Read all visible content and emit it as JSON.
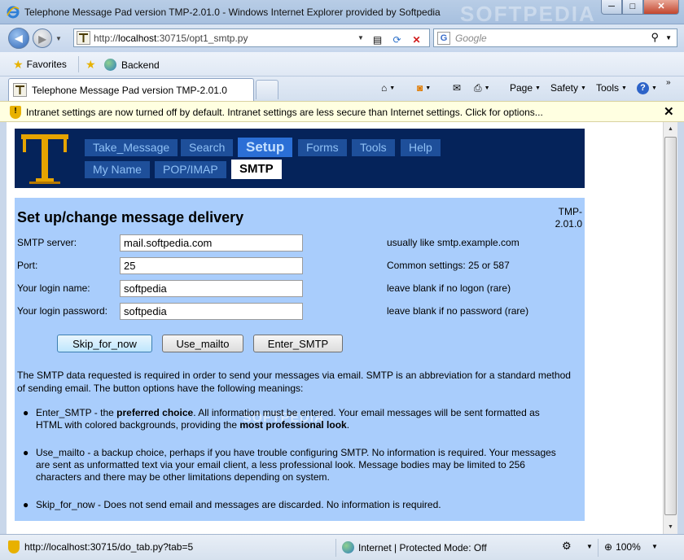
{
  "window": {
    "title": "Telephone Message Pad version TMP-2.01.0 - Windows Internet Explorer provided by Softpedia",
    "watermark": "SOFTPEDIA",
    "controls": {
      "minimize": "─",
      "maximize": "□",
      "close": "✕"
    }
  },
  "address_bar": {
    "url_prefix": "http://",
    "url_host": "localhost",
    "url_rest": ":30715/opt1_smtp.py"
  },
  "search": {
    "placeholder": "Google",
    "engine_letter": "G"
  },
  "favorites_bar": {
    "favorites_label": "Favorites",
    "link_backend": "Backend"
  },
  "tab": {
    "label": "Telephone Message Pad version TMP-2.01.0"
  },
  "command_bar": {
    "page": "Page",
    "safety": "Safety",
    "tools": "Tools",
    "help": "?"
  },
  "info_bar": {
    "message": "Intranet settings are now turned off by default. Intranet settings are less secure than Internet settings. Click for options...",
    "close": "✕"
  },
  "app_nav": {
    "logo_letter": "T",
    "main_tabs": [
      {
        "label": "Take_Message"
      },
      {
        "label": "Search"
      },
      {
        "label": "Setup"
      },
      {
        "label": "Forms"
      },
      {
        "label": "Tools"
      },
      {
        "label": "Help"
      }
    ],
    "sub_tabs": [
      {
        "label": "My Name"
      },
      {
        "label": "POP/IMAP"
      },
      {
        "label": "SMTP"
      }
    ],
    "active_main": "Setup",
    "active_sub": "SMTP"
  },
  "form": {
    "heading": "Set up/change message delivery",
    "version_line1": "TMP-",
    "version_line2": "2.01.0",
    "fields": [
      {
        "label": "SMTP server:",
        "value": "mail.softpedia.com",
        "hint": "usually like smtp.example.com"
      },
      {
        "label": "Port:",
        "value": "25",
        "hint": "Common settings: 25 or 587"
      },
      {
        "label": "Your login name:",
        "value": "softpedia",
        "hint": "leave blank if no logon (rare)"
      },
      {
        "label": "Your login password:",
        "value": "softpedia",
        "hint": "leave blank if no password (rare)"
      }
    ],
    "buttons": {
      "skip": "Skip_for_now",
      "mailto": "Use_mailto",
      "enter_smtp": "Enter_SMTP"
    },
    "intro": "The SMTP data requested is required in order to send your messages via email. SMTP is an abbreviation for a standard method of sending email. The button options have the following meanings:",
    "bullets": {
      "b1_a": "Enter_SMTP - the ",
      "b1_b": "preferred choice",
      "b1_c": ". All information must be entered. Your email messages will be sent formatted as HTML with colored backgrounds, providing the ",
      "b1_d": "most professional look",
      "b1_e": ".",
      "b2": "Use_mailto - a backup choice, perhaps if you have trouble configuring SMTP. No information is required. Your messages are sent as unformatted text via your email client, a less professional look. Message bodies may be limited to 256 characters and there may be other limitations depending on system.",
      "b3": "Skip_for_now - Does not send email and messages are discarded. No information is required."
    },
    "page_watermark": "SOFTPEDIA"
  },
  "status_bar": {
    "url": "http://localhost:30715/do_tab.py?tab=5",
    "zone": "Internet | Protected Mode: Off",
    "zoom": "100%"
  },
  "colors": {
    "header_bg": "#05235a",
    "nav_button": "#1e4f9a",
    "nav_active": "#2b6fd6",
    "panel_bg": "#a9cdfc",
    "infobar_bg": "#ffffe1"
  }
}
